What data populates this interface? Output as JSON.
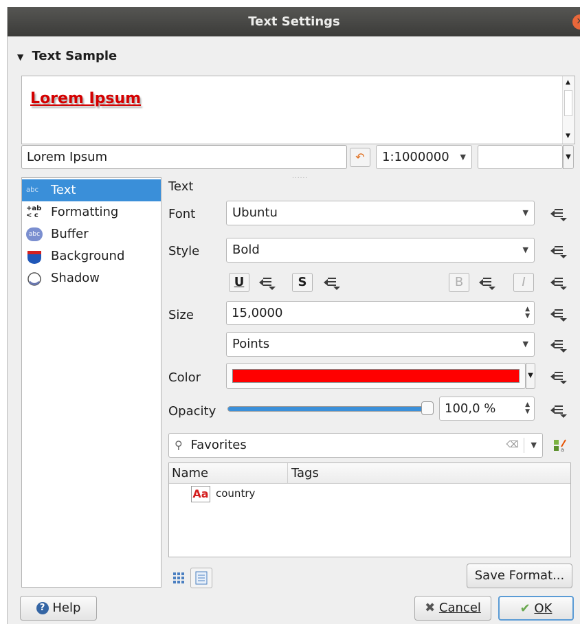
{
  "window": {
    "title": "Text Settings",
    "close_glyph": "✕"
  },
  "sample": {
    "section_title": "Text Sample",
    "preview_text": "Lorem Ipsum",
    "sample_input": "Lorem Ipsum",
    "scale": "1:1000000",
    "preview_color": "#d40000"
  },
  "sidebar": {
    "items": [
      {
        "label": "Text",
        "icon": "abc-text-icon",
        "selected": true
      },
      {
        "label": "Formatting",
        "icon": "formatting-icon"
      },
      {
        "label": "Buffer",
        "icon": "buffer-icon"
      },
      {
        "label": "Background",
        "icon": "background-icon"
      },
      {
        "label": "Shadow",
        "icon": "shadow-icon"
      }
    ]
  },
  "text_panel": {
    "heading": "Text",
    "font_label": "Font",
    "font_value": "Ubuntu",
    "style_label": "Style",
    "style_value": "Bold",
    "underline": "U",
    "strike": "S",
    "bold": "B",
    "italic": "I",
    "size_label": "Size",
    "size_value": "15,0000",
    "unit_value": "Points",
    "color_label": "Color",
    "color_value": "#ff0000",
    "opacity_label": "Opacity",
    "opacity_value": "100,0 %",
    "opacity_fraction": 1.0
  },
  "styles": {
    "search_placeholder": "Favorites",
    "columns": [
      "Name",
      "Tags"
    ],
    "rows": [
      {
        "name": "country",
        "tags": "",
        "icon": "text-format-icon"
      }
    ],
    "save_format": "Save Format..."
  },
  "footer": {
    "help": "Help",
    "cancel": "Cancel",
    "ok": "OK"
  }
}
